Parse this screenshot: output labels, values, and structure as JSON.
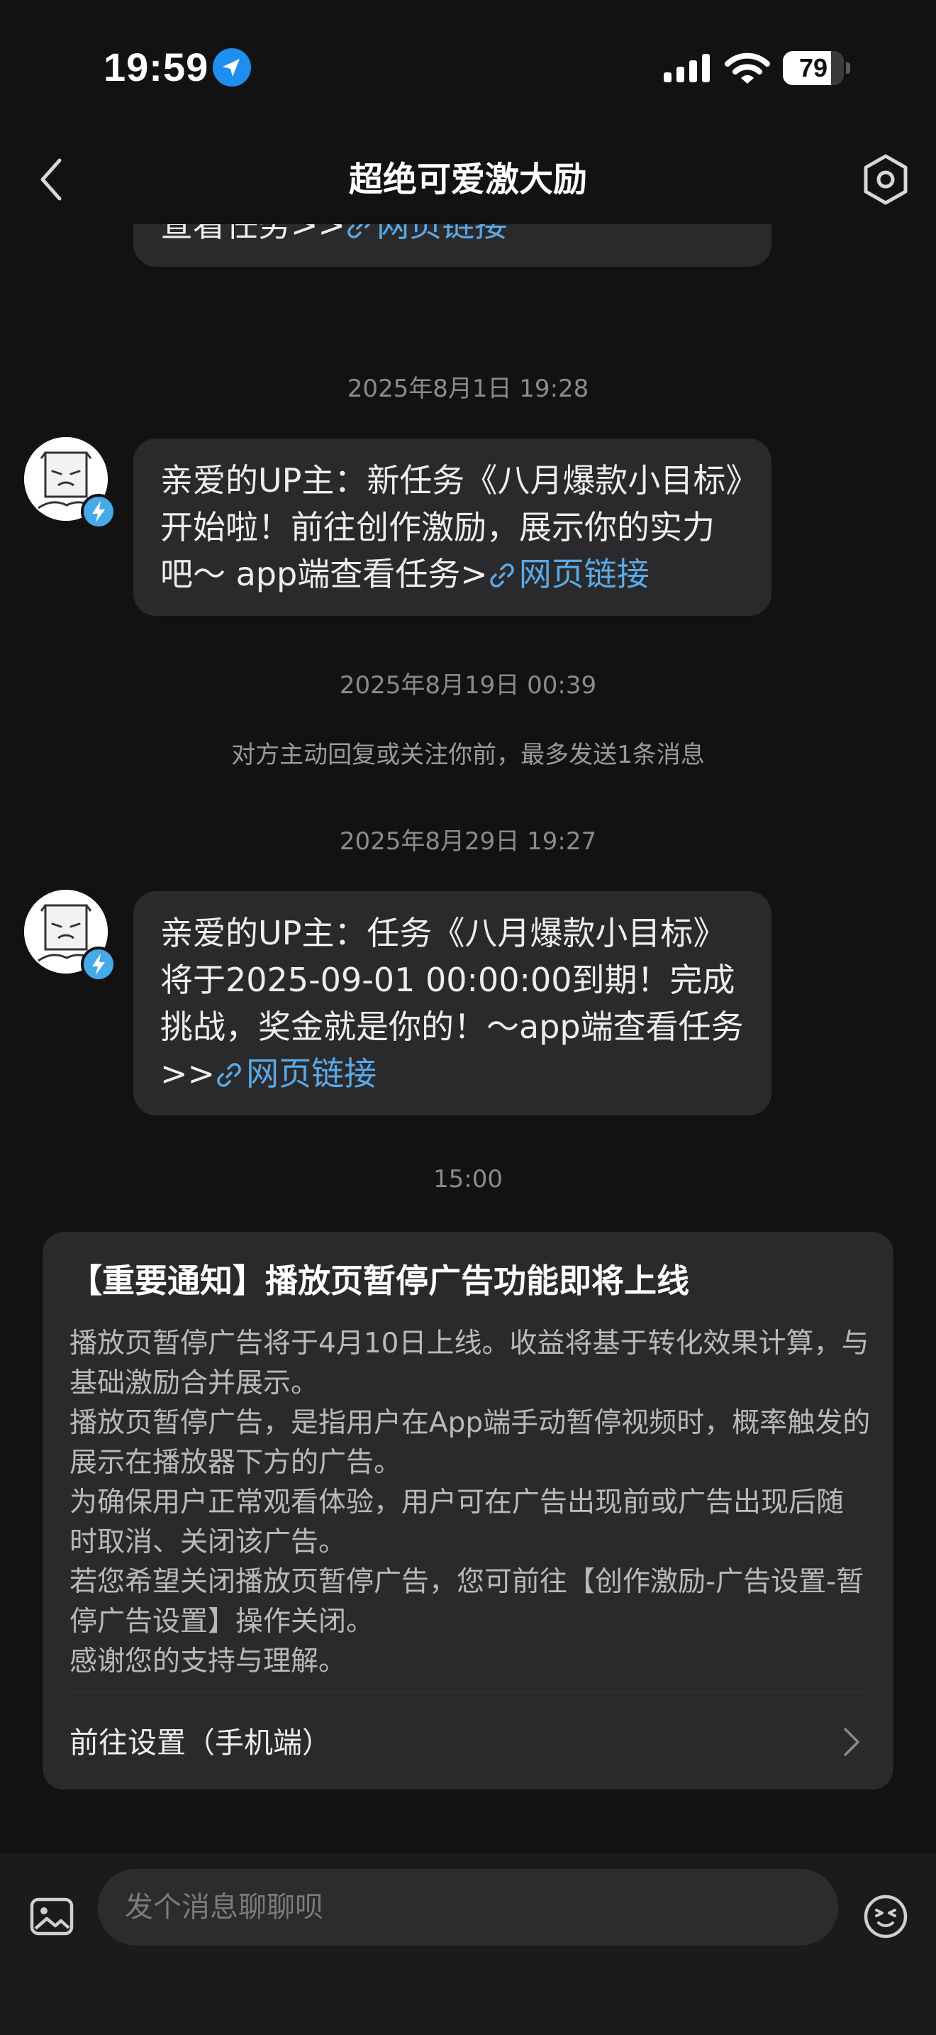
{
  "status_bar": {
    "time": "19:59",
    "battery": "79",
    "battery_level_percent": 79
  },
  "nav": {
    "title": "超绝可爱激大励"
  },
  "messages": [
    {
      "text": "期！完成挑战，奖金就是你的！～app端查看任务>>",
      "link": "网页链接"
    },
    {
      "timestamp": "2025年8月1日 19:28",
      "text": "亲爱的UP主：新任务《八月爆款小目标》开始啦！前往创作激励，展示你的实力吧～ app端查看任务>",
      "link": "网页链接"
    },
    {
      "timestamp": "2025年8月29日 19:27",
      "text": "亲爱的UP主：任务《八月爆款小目标》将于2025-09-01 00:00:00到期！完成挑战，奖金就是你的！～app端查看任务>>",
      "link": "网页链接"
    }
  ],
  "timestamp_aug19": "2025年8月19日 00:39",
  "system_notice": "对方主动回复或关注你前，最多发送1条消息",
  "timestamp_today": "15:00",
  "notice": {
    "title": "【重要通知】播放页暂停广告功能即将上线",
    "body": [
      "播放页暂停广告将于4月10日上线。收益将基于转化效果计算，与基础激励合并展示。",
      "播放页暂停广告，是指用户在App端手动暂停视频时，概率触发的展示在播放器下方的广告。",
      "为确保用户正常观看体验，用户可在广告出现前或广告出现后随时取消、关闭该广告。",
      "若您希望关闭播放页暂停广告，您可前往【创作激励-广告设置-暂停广告设置】操作关闭。",
      "感谢您的支持与理解。"
    ],
    "action_label": "前往设置（手机端）"
  },
  "input": {
    "placeholder": "发个消息聊聊呗",
    "value": ""
  },
  "icons": {
    "location": "location-arrow-icon",
    "signal": "signal-icon",
    "wifi": "wifi-icon",
    "back": "back-icon",
    "settings": "settings-icon",
    "link": "link-icon",
    "image": "image-icon",
    "emoji": "emoji-icon",
    "chevron": "chevron-right-icon"
  },
  "colors": {
    "background": "#121212",
    "bubble": "#2a2a2c",
    "link": "#5aa9e6",
    "badge": "#45a9ea",
    "location": "#1f8ef1"
  }
}
